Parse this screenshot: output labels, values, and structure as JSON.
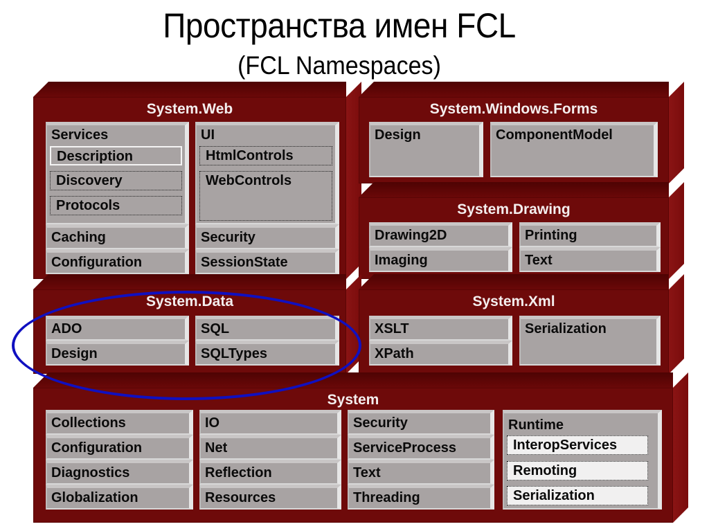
{
  "title": "Пространства имен FCL",
  "subtitle": "(FCL Namespaces)",
  "colors": {
    "panel": "#6e0a0a",
    "box": "#a8a3a3",
    "highlight": "#1010c0"
  },
  "panels": {
    "web": {
      "title": "System.Web",
      "services": {
        "label": "Services",
        "items": [
          "Description",
          "Discovery",
          "Protocols"
        ]
      },
      "ui": {
        "label": "UI",
        "items": [
          "HtmlControls",
          "WebControls"
        ]
      },
      "left_rows": [
        "Caching",
        "Configuration"
      ],
      "right_rows": [
        "Security",
        "SessionState"
      ]
    },
    "forms": {
      "title": "System.Windows.Forms",
      "items": [
        "Design",
        "ComponentModel"
      ]
    },
    "drawing": {
      "title": "System.Drawing",
      "left_rows": [
        "Drawing2D",
        "Imaging"
      ],
      "right_rows": [
        "Printing",
        "Text"
      ]
    },
    "data": {
      "title": "System.Data",
      "left_rows": [
        "ADO",
        "Design"
      ],
      "right_rows": [
        "SQL",
        "SQLTypes"
      ]
    },
    "xml": {
      "title": "System.Xml",
      "left_rows": [
        "XSLT",
        "XPath"
      ],
      "right": "Serialization"
    },
    "system": {
      "title": "System",
      "col1": [
        "Collections",
        "Configuration",
        "Diagnostics",
        "Globalization"
      ],
      "col2": [
        "IO",
        "Net",
        "Reflection",
        "Resources"
      ],
      "col3": [
        "Security",
        "ServiceProcess",
        "Text",
        "Threading"
      ],
      "runtime": {
        "label": "Runtime",
        "items": [
          "InteropServices",
          "Remoting",
          "Serialization"
        ]
      }
    }
  }
}
